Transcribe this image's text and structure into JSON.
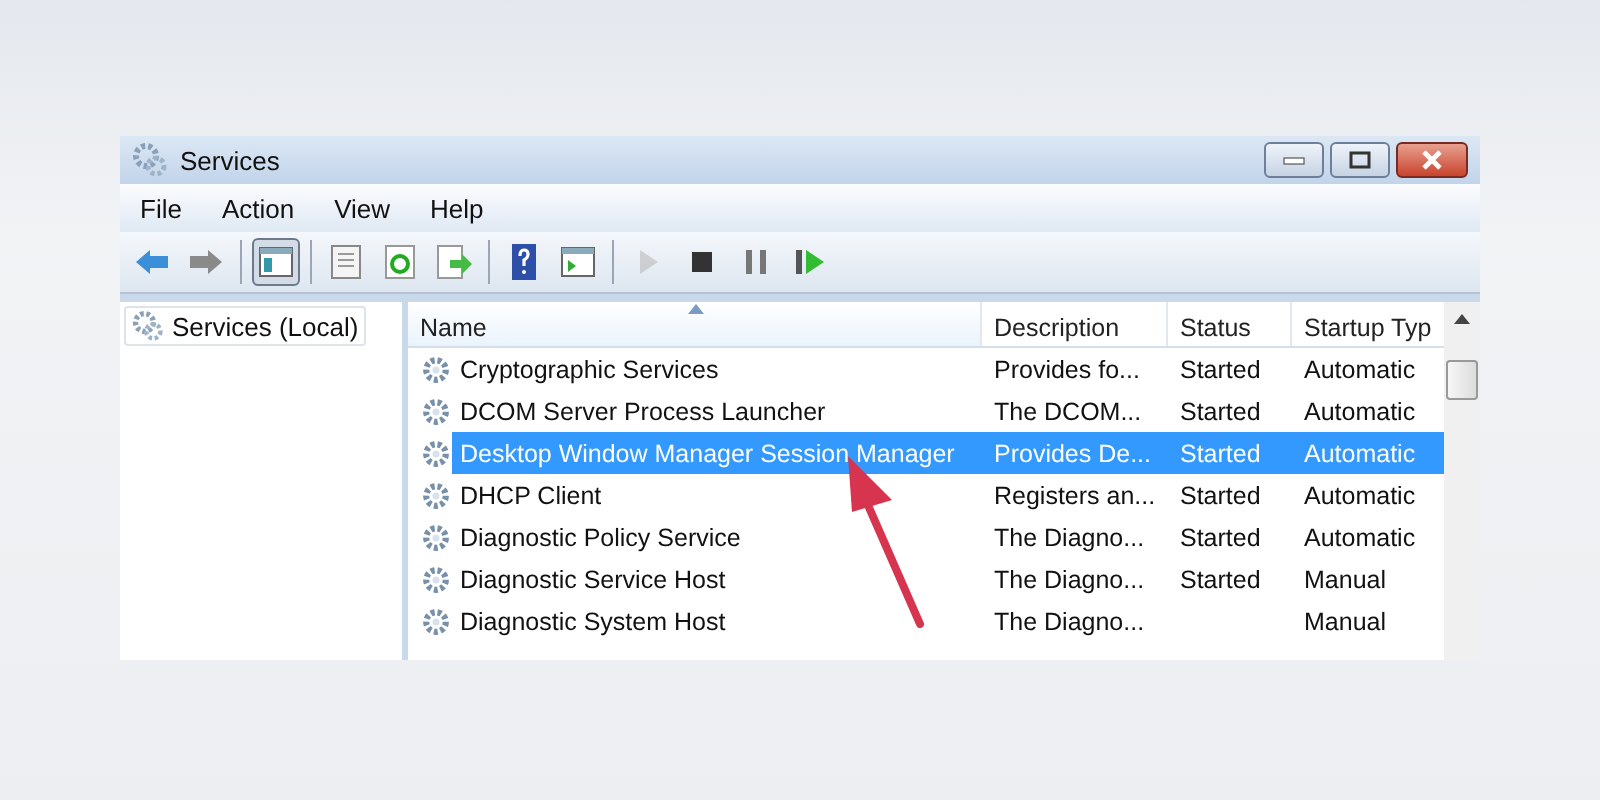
{
  "window": {
    "title": "Services"
  },
  "menu": [
    "File",
    "Action",
    "View",
    "Help"
  ],
  "toolbar": [
    {
      "kind": "back",
      "pressed": false,
      "disabled": false
    },
    {
      "kind": "forward",
      "pressed": false,
      "disabled": false
    },
    {
      "kind": "sep"
    },
    {
      "kind": "tree",
      "pressed": true,
      "disabled": false
    },
    {
      "kind": "sep"
    },
    {
      "kind": "props",
      "pressed": false,
      "disabled": false
    },
    {
      "kind": "refresh",
      "pressed": false,
      "disabled": false
    },
    {
      "kind": "export",
      "pressed": false,
      "disabled": false
    },
    {
      "kind": "sep"
    },
    {
      "kind": "help",
      "pressed": false,
      "disabled": false
    },
    {
      "kind": "view",
      "pressed": false,
      "disabled": false
    },
    {
      "kind": "sep"
    },
    {
      "kind": "play",
      "pressed": false,
      "disabled": true
    },
    {
      "kind": "stop",
      "pressed": false,
      "disabled": false
    },
    {
      "kind": "pause",
      "pressed": false,
      "disabled": false
    },
    {
      "kind": "resume",
      "pressed": false,
      "disabled": false
    }
  ],
  "tree": {
    "label": "Services (Local)",
    "selected": false
  },
  "table": {
    "columns": [
      "Name",
      "Description",
      "Status",
      "Startup Typ"
    ],
    "rows": [
      {
        "name": "Cryptographic Services",
        "description": "Provides fo...",
        "status": "Started",
        "startup": "Automatic",
        "selected": false
      },
      {
        "name": "DCOM Server Process Launcher",
        "description": "The DCOM...",
        "status": "Started",
        "startup": "Automatic",
        "selected": false
      },
      {
        "name": "Desktop Window Manager Session Manager",
        "description": "Provides De...",
        "status": "Started",
        "startup": "Automatic",
        "selected": true
      },
      {
        "name": "DHCP Client",
        "description": "Registers an...",
        "status": "Started",
        "startup": "Automatic",
        "selected": false
      },
      {
        "name": "Diagnostic Policy Service",
        "description": "The Diagno...",
        "status": "Started",
        "startup": "Automatic",
        "selected": false
      },
      {
        "name": "Diagnostic Service Host",
        "description": "The Diagno...",
        "status": "Started",
        "startup": "Manual",
        "selected": false
      },
      {
        "name": "Diagnostic System Host",
        "description": "The Diagno...",
        "startup": "Manual",
        "selected": false
      }
    ]
  }
}
